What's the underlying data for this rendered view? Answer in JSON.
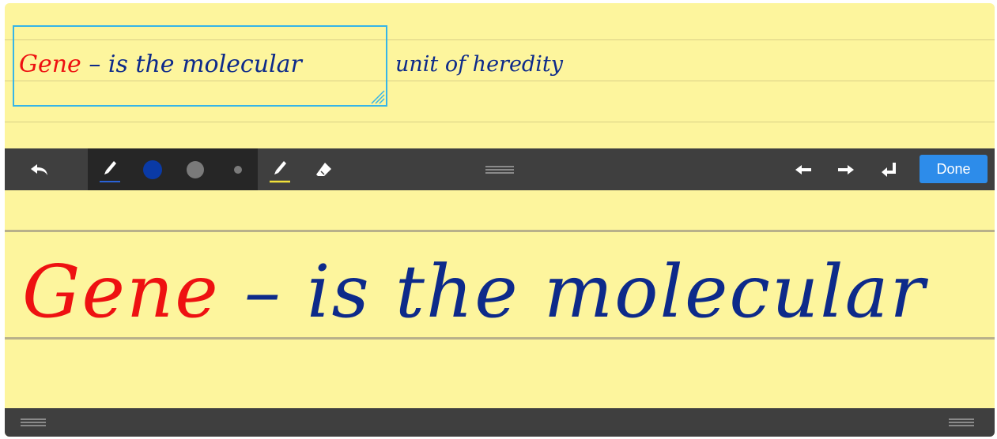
{
  "colors": {
    "paper": "#fdf59d",
    "ink_red": "#ee1111",
    "ink_blue": "#0d2a8a",
    "selection": "#36b5e8",
    "accent": "#2d8cea",
    "highlighter": "#f2e23a"
  },
  "note": {
    "selected_word_red": "Gene",
    "selected_rest_blue": " – is the molecular",
    "trailing_text": "unit of heredity"
  },
  "toolbar": {
    "icons": [
      "undo-icon",
      "pen-icon",
      "blue-color-swatch",
      "gray-large-swatch",
      "gray-small-swatch",
      "highlighter-icon",
      "eraser-icon",
      "drag-handle-icon",
      "arrow-left-icon",
      "arrow-right-icon",
      "return-icon"
    ],
    "done_label": "Done"
  },
  "writing": {
    "word_red": "Gene",
    "rest_blue": " – is the molecular"
  },
  "bottombar": {
    "icons": [
      "drag-handle-left-icon",
      "drag-handle-right-icon"
    ]
  }
}
